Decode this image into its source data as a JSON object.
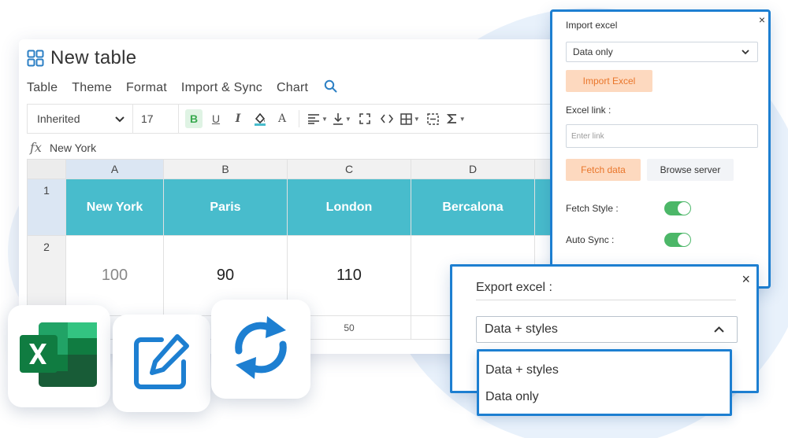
{
  "app": {
    "title": "New table",
    "menu": [
      "Table",
      "Theme",
      "Format",
      "Import & Sync",
      "Chart"
    ]
  },
  "toolbar": {
    "font": "Inherited",
    "font_size": "17",
    "bold": "B",
    "underline": "U",
    "italic": "I",
    "text_color": "A"
  },
  "formula": {
    "fx": "fx",
    "value": "New York"
  },
  "grid": {
    "columns": [
      "A",
      "B",
      "C",
      "D"
    ],
    "rows": [
      "1",
      "2"
    ],
    "header_row": [
      "New York",
      "Paris",
      "London",
      "Bercalona"
    ],
    "value_row": [
      "100",
      "90",
      "110",
      ""
    ],
    "partial_row": [
      "",
      "",
      "50",
      ""
    ]
  },
  "import_panel": {
    "title": "Import excel",
    "mode": "Data only",
    "import_button": "Import Excel",
    "link_label": "Excel link :",
    "link_placeholder": "Enter link",
    "fetch_button": "Fetch data",
    "browse_button": "Browse server",
    "fetch_style_label": "Fetch Style :",
    "auto_sync_label": "Auto Sync :",
    "close": "×"
  },
  "export_panel": {
    "title": "Export excel :",
    "selected": "Data + styles",
    "options": [
      "Data + styles",
      "Data only"
    ],
    "close": "×"
  },
  "colors": {
    "accent": "#1d7fd1",
    "header_teal": "#48bccc",
    "toggle_green": "#4cb768",
    "orange_button_bg": "#fdd9bf",
    "orange_button_text": "#e9762b"
  },
  "icons": [
    "grid-icon",
    "search-icon",
    "fx-icon",
    "excel-logo-icon",
    "edit-icon",
    "sync-icon"
  ]
}
